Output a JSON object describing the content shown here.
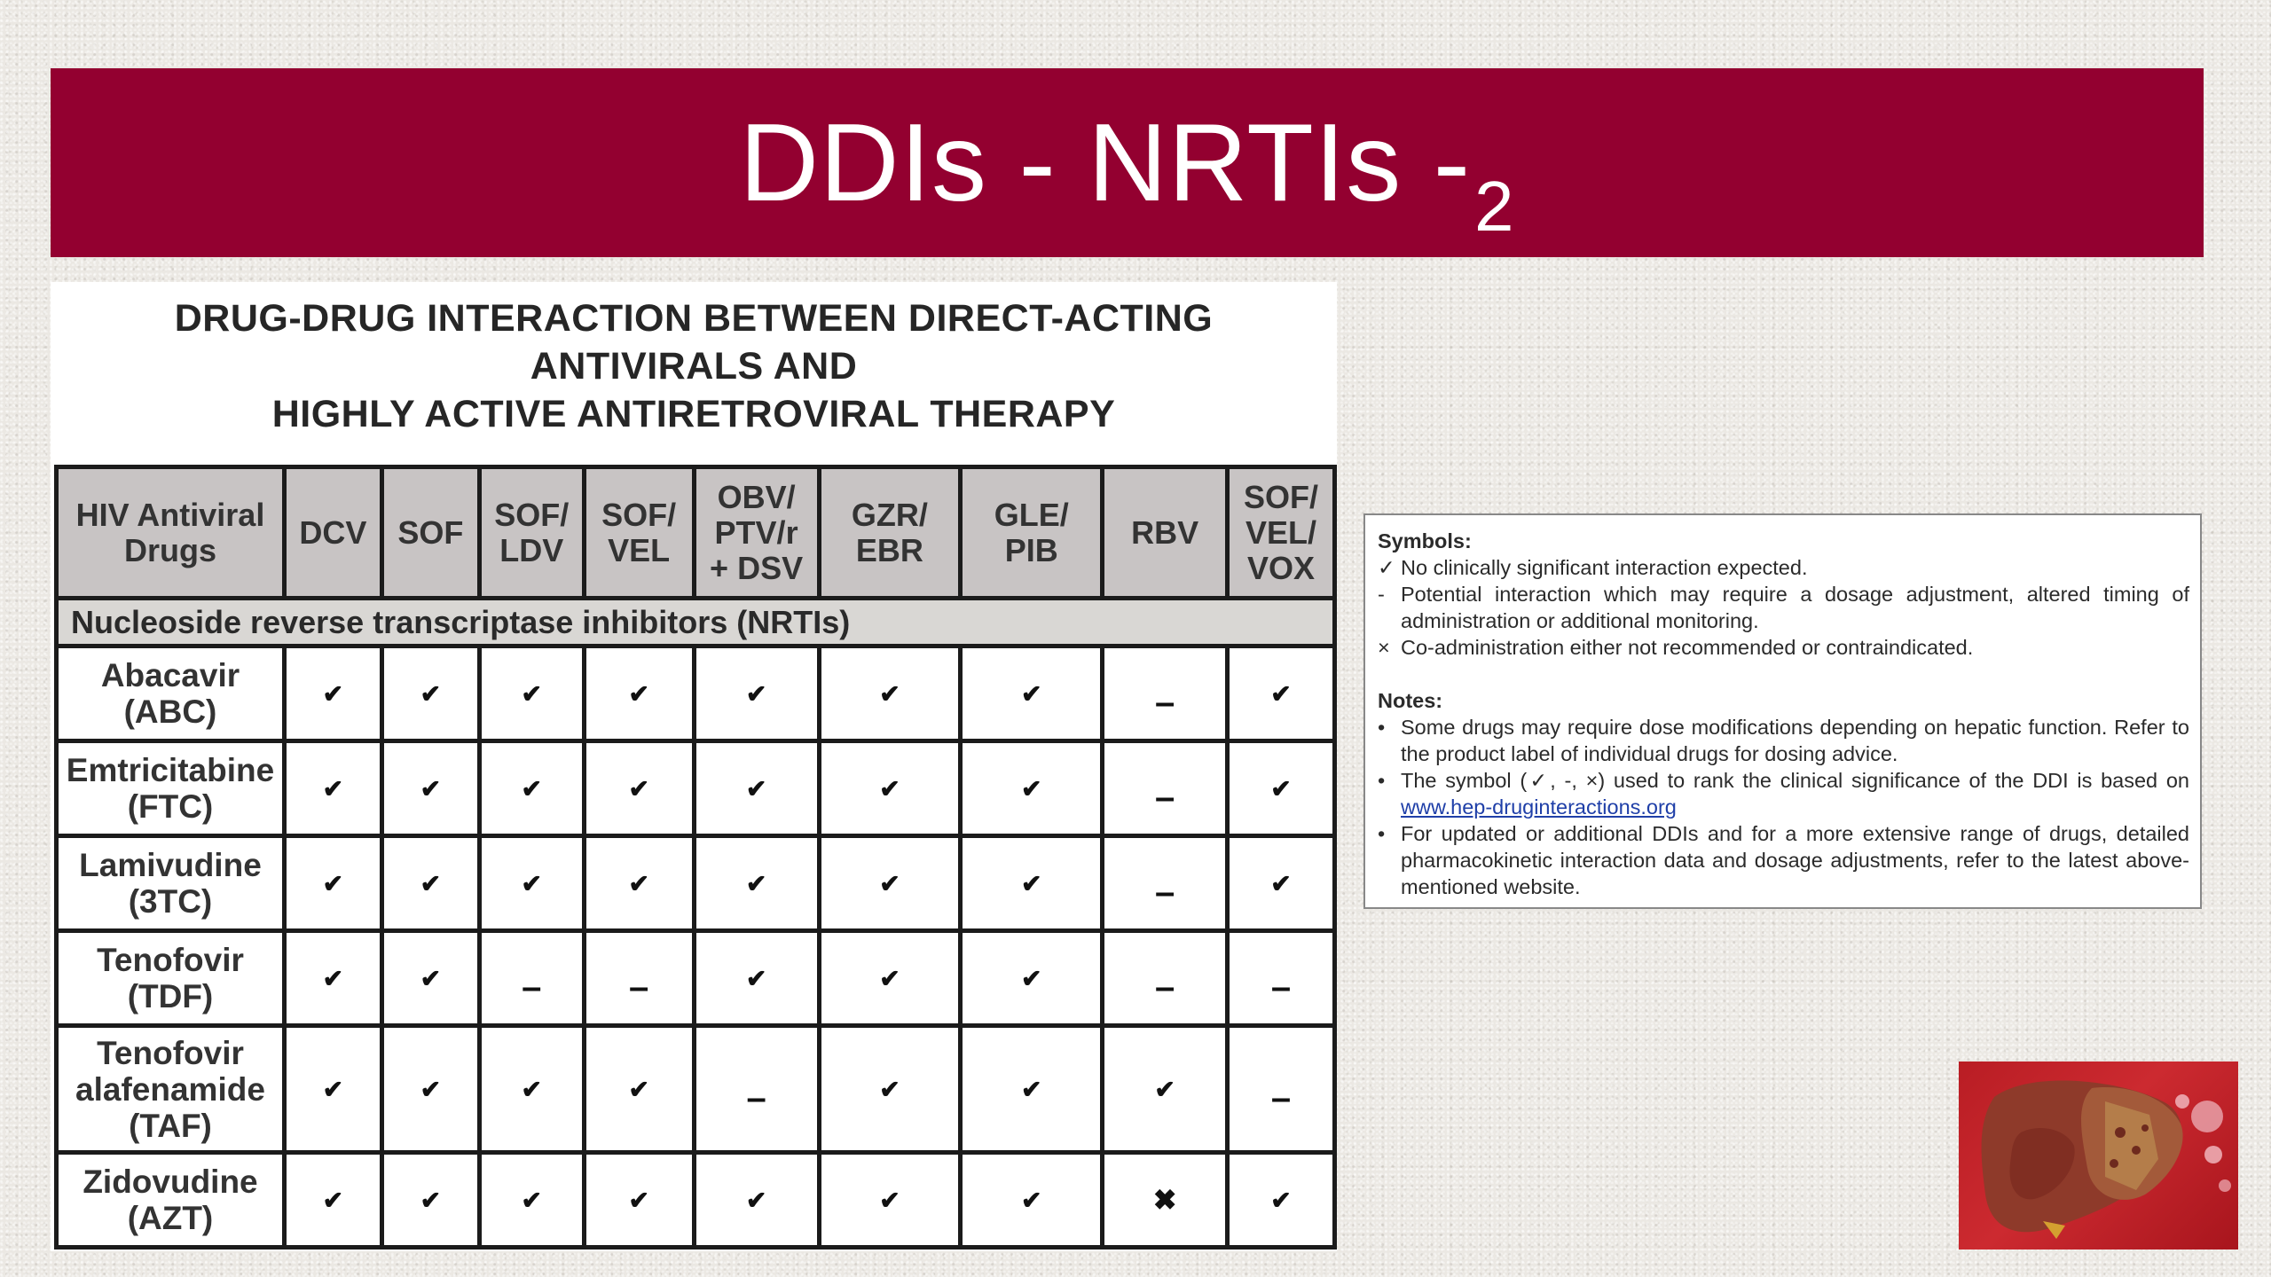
{
  "slide": {
    "title": "DDIs - NRTIs -",
    "title_subscript": "2"
  },
  "panel": {
    "heading_lines": [
      "DRUG-DRUG INTERACTION BETWEEN DIRECT-ACTING",
      "ANTIVIRALS AND",
      "HIGHLY ACTIVE ANTIRETROVIRAL THERAPY"
    ]
  },
  "table": {
    "columns": [
      [
        "HIV Antiviral",
        "Drugs"
      ],
      [
        "DCV"
      ],
      [
        "SOF"
      ],
      [
        "SOF/",
        "LDV"
      ],
      [
        "SOF/",
        "VEL"
      ],
      [
        "OBV/",
        "PTV/r",
        "+ DSV"
      ],
      [
        "GZR/",
        "EBR"
      ],
      [
        "GLE/",
        "PIB"
      ],
      [
        "RBV"
      ],
      [
        "SOF/",
        "VEL/",
        "VOX"
      ]
    ],
    "section": "Nucleoside reverse transcriptase inhibitors (NRTIs)",
    "rows": [
      {
        "drug": [
          "Abacavir",
          "(ABC)"
        ],
        "cells": [
          "✔",
          "✔",
          "✔",
          "✔",
          "✔",
          "✔",
          "✔",
          "–",
          "✔"
        ]
      },
      {
        "drug": [
          "Emtricitabine",
          "(FTC)"
        ],
        "cells": [
          "✔",
          "✔",
          "✔",
          "✔",
          "✔",
          "✔",
          "✔",
          "–",
          "✔"
        ]
      },
      {
        "drug": [
          "Lamivudine",
          "(3TC)"
        ],
        "cells": [
          "✔",
          "✔",
          "✔",
          "✔",
          "✔",
          "✔",
          "✔",
          "–",
          "✔"
        ]
      },
      {
        "drug": [
          "Tenofovir",
          "(TDF)"
        ],
        "cells": [
          "✔",
          "✔",
          "–",
          "–",
          "✔",
          "✔",
          "✔",
          "–",
          "–"
        ]
      },
      {
        "drug": [
          "Tenofovir",
          "alafenamide",
          "(TAF)"
        ],
        "cells": [
          "✔",
          "✔",
          "✔",
          "✔",
          "–",
          "✔",
          "✔",
          "✔",
          "–"
        ]
      },
      {
        "drug": [
          "Zidovudine",
          "(AZT)"
        ],
        "cells": [
          "✔",
          "✔",
          "✔",
          "✔",
          "✔",
          "✔",
          "✔",
          "✖",
          "✔"
        ]
      }
    ]
  },
  "legend": {
    "symbols_heading": "Symbols:",
    "symbols": [
      {
        "mark": "✓",
        "text": "No clinically significant interaction expected."
      },
      {
        "mark": "-",
        "text": "Potential interaction which may require a dosage adjustment, altered timing of administration or additional monitoring."
      },
      {
        "mark": "×",
        "text": "Co-administration either not recommended or contraindicated."
      }
    ],
    "notes_heading": "Notes:",
    "notes": [
      {
        "mark": "•",
        "text": "Some drugs may require dose modifications depending on hepatic function. Refer to the product label of individual drugs for dosing advice."
      },
      {
        "mark": "•",
        "text": "The symbol (✓, -, ×) used to rank the clinical significance of the DDI is based on",
        "link": "www.hep-druginteractions.org"
      },
      {
        "mark": "•",
        "text": "For updated or additional DDIs and for a more extensive range of drugs, detailed pharmacokinetic interaction data and dosage adjustments, refer to the latest above-mentioned website."
      }
    ]
  },
  "colors": {
    "banner": "#930030",
    "header_fill": "#c8c4c4",
    "section_fill": "#d9d7d4"
  },
  "icons": {
    "corner_image": "liver-illustration"
  }
}
